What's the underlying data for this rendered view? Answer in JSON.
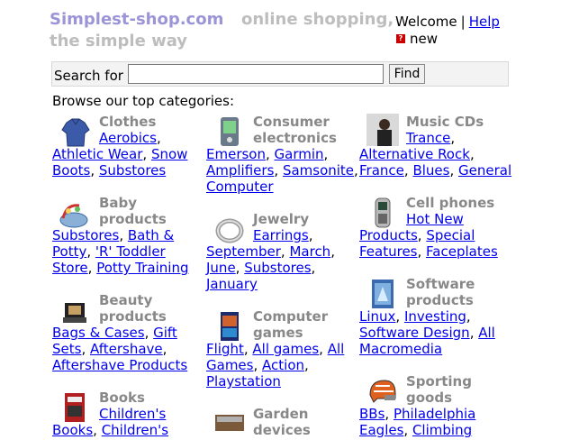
{
  "header": {
    "brand": "Simplest-shop.com",
    "tagline_line1": "online shopping,",
    "tagline_line2": "the simple way",
    "welcome": "Welcome",
    "separator": "|",
    "help": "Help",
    "new_label": "new"
  },
  "search": {
    "label": "Search for",
    "value": "",
    "button": "Find"
  },
  "browse_heading": "Browse our top categories:",
  "categories": {
    "clothes": {
      "title": "Clothes",
      "icon": "shirt-icon",
      "links": [
        "Aerobics",
        "Athletic Wear",
        "Snow Boots",
        "Substores"
      ]
    },
    "electronics": {
      "title": "Consumer electronics",
      "icon": "pda-icon",
      "links": [
        "Emerson",
        "Garmin",
        "Amplifiers",
        "Samsonite",
        "Computer"
      ]
    },
    "music": {
      "title": "Music CDs",
      "icon": "album-cover-icon",
      "links": [
        "Trance",
        "Alternative Rock",
        "France",
        "Blues",
        "General"
      ]
    },
    "baby": {
      "title": "Baby products",
      "icon": "baby-seat-icon",
      "links": [
        "Substores",
        "Bath & Potty",
        "'R' Toddler Store",
        "Potty Training"
      ]
    },
    "jewelry": {
      "title": "Jewelry",
      "icon": "ring-icon",
      "links": [
        "Earrings",
        "September",
        "March",
        "June",
        "Substores",
        "January"
      ]
    },
    "cellphones": {
      "title": "Cell phones",
      "icon": "phone-icon",
      "links": [
        "Hot New Products",
        "Special Features",
        "Faceplates"
      ]
    },
    "beauty": {
      "title": "Beauty products",
      "icon": "compact-icon",
      "links": [
        "Bags & Cases",
        "Gift Sets",
        "Aftershave",
        "Aftershave Products"
      ]
    },
    "games": {
      "title": "Computer games",
      "icon": "game-box-icon",
      "links": [
        "Flight",
        "All games",
        "All Games",
        "Action",
        "Playstation"
      ]
    },
    "software": {
      "title": "Software products",
      "icon": "software-box-icon",
      "links": [
        "Linux",
        "Investing",
        "Software Design",
        "All",
        "Macromedia"
      ]
    },
    "books": {
      "title": "Books",
      "icon": "book-icon",
      "links": [
        "Children's",
        "Books",
        "Children's"
      ]
    },
    "garden": {
      "title": "Garden devices",
      "icon": "garden-tool-icon",
      "links": []
    },
    "sporting": {
      "title": "Sporting goods",
      "icon": "helmet-icon",
      "links": [
        "BBs",
        "Philadelphia",
        "Eagles",
        "Climbing"
      ]
    }
  }
}
